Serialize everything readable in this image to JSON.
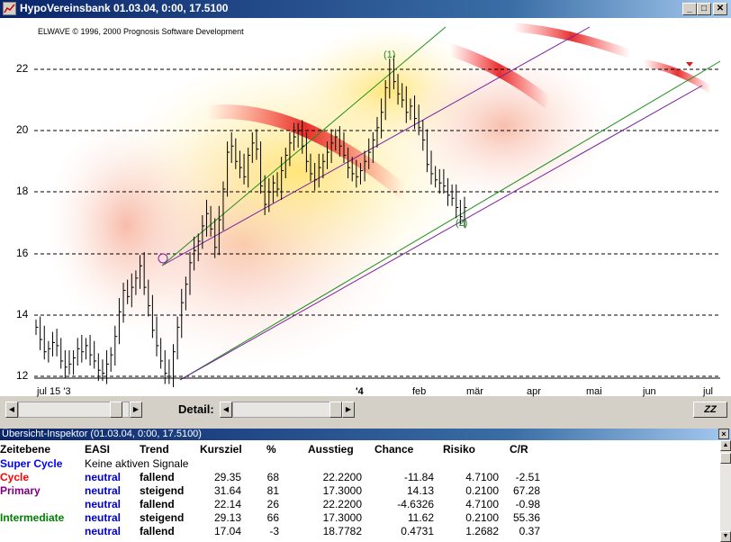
{
  "window": {
    "title": "HypoVereinsbank   01.03.04,  0:00,  17.5100",
    "minimize_label": "_",
    "maximize_label": "□",
    "close_label": "✕"
  },
  "chart": {
    "copyright": "ELWAVE © 1996, 2000 Prognosis Software Development",
    "y_ticks": [
      "22",
      "20",
      "18",
      "16",
      "14",
      "12"
    ],
    "x_labels": [
      "jul 15 '3",
      "'4",
      "feb",
      "mär",
      "apr",
      "mai",
      "jun",
      "jul"
    ],
    "wave_labels": [
      "(1)",
      "(2)"
    ],
    "colors": {
      "primary_channel": "#7a1fa2",
      "intermediate_channel": "#1a8f1a",
      "target_zone": "#e41b1b",
      "bars": "#000000"
    }
  },
  "chart_data": {
    "type": "ohlc",
    "title": "HypoVereinsbank",
    "ylim": [
      11.8,
      23.0
    ],
    "y_ticks": [
      12,
      14,
      16,
      18,
      20,
      22
    ],
    "close_series": [
      13.6,
      13.2,
      12.8,
      12.9,
      13.1,
      13.0,
      12.5,
      12.3,
      12.4,
      12.6,
      12.9,
      12.8,
      13.0,
      12.7,
      12.5,
      12.2,
      12.1,
      12.4,
      12.7,
      13.3,
      14.1,
      14.8,
      14.6,
      14.9,
      15.2,
      15.6,
      14.9,
      14.3,
      13.5,
      13.0,
      12.5,
      12.1,
      12.0,
      12.8,
      13.6,
      14.4,
      15.0,
      15.7,
      16.1,
      16.4,
      16.9,
      17.3,
      16.8,
      16.2,
      17.1,
      18.1,
      19.3,
      19.5,
      19.0,
      18.8,
      18.5,
      19.2,
      19.6,
      19.4,
      18.2,
      17.6,
      18.0,
      18.3,
      18.1,
      18.7,
      19.2,
      19.6,
      19.8,
      20.0,
      19.5,
      19.0,
      18.6,
      18.4,
      18.8,
      19.0,
      19.3,
      19.6,
      19.8,
      19.5,
      19.2,
      18.8,
      18.6,
      18.5,
      18.7,
      19.0,
      19.3,
      19.7,
      20.1,
      20.6,
      21.4,
      22.0,
      21.6,
      21.2,
      21.0,
      20.6,
      20.8,
      20.4,
      20.1,
      19.7,
      18.9,
      18.6,
      18.4,
      18.3,
      18.2,
      17.9,
      17.8,
      17.5,
      17.2,
      17.5
    ],
    "labels": [
      "(1)",
      "(2)"
    ]
  },
  "menu": {
    "detail_label": "Detail:",
    "zz_label": "ZZ"
  },
  "inspector": {
    "title": "Übersicht-Inspektor (01.03.04, 0:00, 17.5100)",
    "close_label": "×",
    "headers": [
      "Zeitebene",
      "EASI",
      "Trend",
      "Kursziel",
      "%",
      "Ausstieg",
      "Chance",
      "Risiko",
      "C/R"
    ],
    "rows": [
      {
        "level": "Super Cycle",
        "level_color": "#0000ff",
        "easi": "Keine aktiven Signale",
        "easi_color": "#000000",
        "trend": "",
        "kursziel": "",
        "pct": "",
        "ausstieg": "",
        "chance": "",
        "risiko": "",
        "cr": ""
      },
      {
        "level": "Cycle",
        "level_color": "#ff0000",
        "easi": "neutral",
        "easi_color": "#0000cc",
        "trend": "fallend",
        "kursziel": "29.35",
        "pct": "68",
        "ausstieg": "22.2200",
        "chance": "-11.84",
        "risiko": "4.7100",
        "cr": "-2.51"
      },
      {
        "level": "Primary",
        "level_color": "#800080",
        "easi": "neutral",
        "easi_color": "#0000cc",
        "trend": "steigend",
        "kursziel": "31.64",
        "pct": "81",
        "ausstieg": "17.3000",
        "chance": "14.13",
        "risiko": "0.2100",
        "cr": "67.28"
      },
      {
        "level": "",
        "level_color": "#800080",
        "easi": "neutral",
        "easi_color": "#0000cc",
        "trend": "fallend",
        "kursziel": "22.14",
        "pct": "26",
        "ausstieg": "22.2200",
        "chance": "-4.6326",
        "risiko": "4.7100",
        "cr": "-0.98"
      },
      {
        "level": "Intermediate",
        "level_color": "#008000",
        "easi": "neutral",
        "easi_color": "#0000cc",
        "trend": "steigend",
        "kursziel": "29.13",
        "pct": "66",
        "ausstieg": "17.3000",
        "chance": "11.62",
        "risiko": "0.2100",
        "cr": "55.36"
      },
      {
        "level": "",
        "level_color": "#008000",
        "easi": "neutral",
        "easi_color": "#0000cc",
        "trend": "fallend",
        "kursziel": "17.04",
        "pct": "-3",
        "ausstieg": "18.7782",
        "chance": "0.4731",
        "risiko": "1.2682",
        "cr": "0.37"
      }
    ]
  }
}
